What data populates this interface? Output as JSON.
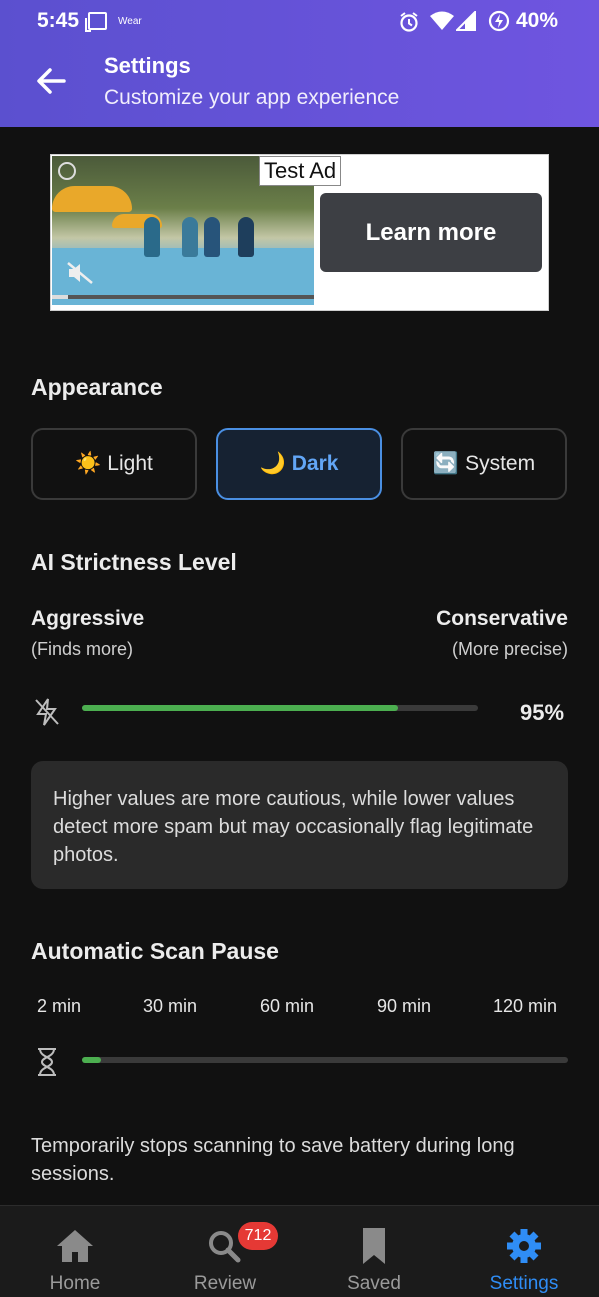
{
  "status_bar": {
    "time": "5:45",
    "wear": "Wear",
    "battery": "40%"
  },
  "header": {
    "title": "Settings",
    "subtitle": "Customize your app experience"
  },
  "ad": {
    "badge": "Test Ad",
    "cta": "Learn more"
  },
  "appearance": {
    "title": "Appearance",
    "options": [
      {
        "icon": "☀️",
        "label": "Light",
        "selected": false
      },
      {
        "icon": "🌙",
        "label": "Dark",
        "selected": true
      },
      {
        "icon": "🔄",
        "label": "System",
        "selected": false
      }
    ]
  },
  "strictness": {
    "title": "AI Strictness Level",
    "left_label": "Aggressive",
    "left_hint": "(Finds more)",
    "right_label": "Conservative",
    "right_hint": "(More precise)",
    "value_text": "95%",
    "value": 0.95,
    "info": "Higher values are more cautious, while lower values detect more spam but may occasionally flag legitimate photos."
  },
  "scan_pause": {
    "title": "Automatic Scan Pause",
    "ticks": [
      "2 min",
      "30 min",
      "60 min",
      "90 min",
      "120 min"
    ],
    "value_fraction": 0.04,
    "description": "Temporarily stops scanning to save battery during long sessions."
  },
  "nav": {
    "items": [
      {
        "label": "Home",
        "active": false
      },
      {
        "label": "Review",
        "badge": "712",
        "active": false
      },
      {
        "label": "Saved",
        "active": false
      },
      {
        "label": "Settings",
        "active": true
      }
    ]
  },
  "colors": {
    "header": "#5b50cf",
    "accent": "#2f8df5",
    "slider": "#4caf50",
    "badge": "#e53935"
  }
}
